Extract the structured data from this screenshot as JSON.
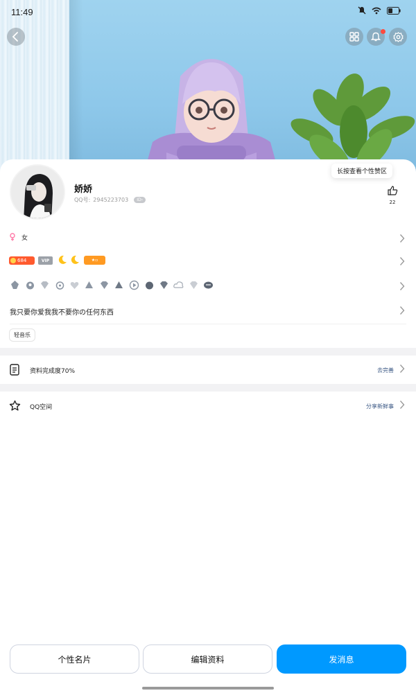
{
  "status_bar": {
    "time": "11:49"
  },
  "icons": {
    "back": "chevron-left-icon",
    "grid": "qr-grid-icon",
    "bell": "bell-icon",
    "gear": "gear-icon",
    "like": "thumbs-up-icon"
  },
  "colors": {
    "accent_blue": "#0099ff",
    "notification_red": "#ff4a3f",
    "level_badge": "#ff5a2e",
    "link_blue": "#3d5a86"
  },
  "profile": {
    "nickname": "娇娇",
    "qq_label": "QQ号:",
    "qq_number": "2945223703",
    "id_badge": "ID",
    "like_tooltip": "长按查看个性赞区",
    "like_count": "22",
    "gender": "女",
    "level": "684",
    "vip_label": "VIP",
    "signature": "我只要你爱我我不要你の任何东西",
    "tags": [
      "轻音乐"
    ]
  },
  "rows": {
    "completion_label": "资料完成度70%",
    "completion_action": "去完善",
    "qzone_label": "QQ空间",
    "qzone_action": "分享新鲜事"
  },
  "buttons": {
    "card": "个性名片",
    "edit": "编辑资料",
    "message": "发消息"
  }
}
